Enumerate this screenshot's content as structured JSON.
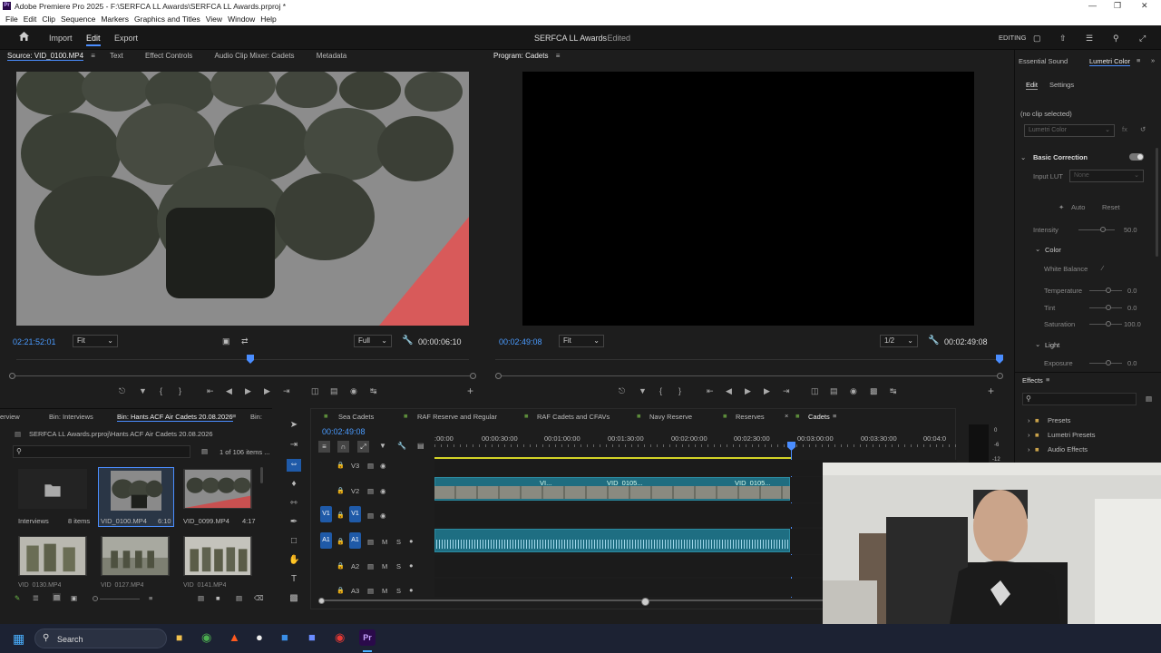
{
  "window": {
    "title": "Adobe Premiere Pro 2025 - F:\\SERFCA LL Awards\\SERFCA LL Awards.prproj *"
  },
  "menu": [
    "File",
    "Edit",
    "Clip",
    "Sequence",
    "Markers",
    "Graphics and Titles",
    "View",
    "Window",
    "Help"
  ],
  "appbar": {
    "import": "Import",
    "edit": "Edit",
    "export": "Export",
    "project_title": "SERFCA LL Awards",
    "status": "- Edited",
    "workspace": "EDITING"
  },
  "source": {
    "tabs": [
      "Source: VID_0100.MP4",
      "Text",
      "Effect Controls",
      "Audio Clip Mixer: Cadets",
      "Metadata"
    ],
    "timecode": "02:21:52:01",
    "zoom": "Fit",
    "resolution": "Full",
    "duration": "00:00:06:10"
  },
  "program": {
    "tab": "Program: Cadets",
    "timecode": "00:02:49:08",
    "zoom": "Fit",
    "resolution": "1/2",
    "duration": "00:02:49:08"
  },
  "lumetri": {
    "tabs": [
      "Essential Sound",
      "Lumetri Color"
    ],
    "subtabs": [
      "Edit",
      "Settings"
    ],
    "no_clip": "(no clip selected)",
    "effect": "Lumetri Color",
    "basic": "Basic Correction",
    "input_lut": "Input LUT",
    "lut_value": "None",
    "auto": "Auto",
    "reset": "Reset",
    "intensity": "Intensity",
    "intensity_val": "50.0",
    "color": "Color",
    "white_balance": "White Balance",
    "temperature": "Temperature",
    "temperature_val": "0.0",
    "tint": "Tint",
    "tint_val": "0.0",
    "saturation": "Saturation",
    "saturation_val": "100.0",
    "light": "Light",
    "exposure": "Exposure",
    "exposure_val": "0.0"
  },
  "effects": {
    "title": "Effects",
    "items": [
      "Presets",
      "Lumetri Presets",
      "Audio Effects"
    ]
  },
  "project": {
    "tabs": [
      "erview",
      "Bin: Interviews",
      "Bin: Hants ACF Air Cadets 20.08.2026",
      "Bin:"
    ],
    "path": "SERFCA LL Awards.prproj\\Hants ACF Air Cadets 20.08.2026",
    "count": "1 of 106 items ...",
    "items": [
      {
        "name": "Interviews",
        "meta": "8 items"
      },
      {
        "name": "VID_0100.MP4",
        "meta": "6:10"
      },
      {
        "name": "VID_0099.MP4",
        "meta": "4:17"
      }
    ],
    "row2": [
      "VID_0130.MP4",
      "VID_0127.MP4",
      "VID_0141.MP4"
    ]
  },
  "timeline": {
    "tabs": [
      "Sea Cadets",
      "RAF Reserve and Regular",
      "RAF Cadets and CFAVs",
      "Navy Reserve",
      "Reserves",
      "Cadets"
    ],
    "timecode": "00:02:49:08",
    "ruler": [
      ":00:00",
      "00:00:30:00",
      "00:01:00:00",
      "00:01:30:00",
      "00:02:00:00",
      "00:02:30:00",
      "00:03:00:00",
      "00:03:30:00",
      "00:04:0"
    ],
    "tracks": [
      "V3",
      "V2",
      "V1",
      "A1",
      "A2",
      "A3"
    ],
    "clip_labels": [
      "VI...",
      "VID_0105...",
      "VID_0105..."
    ],
    "meter": [
      "0",
      "-6",
      "-12"
    ]
  },
  "taskbar": {
    "search": "Search"
  }
}
